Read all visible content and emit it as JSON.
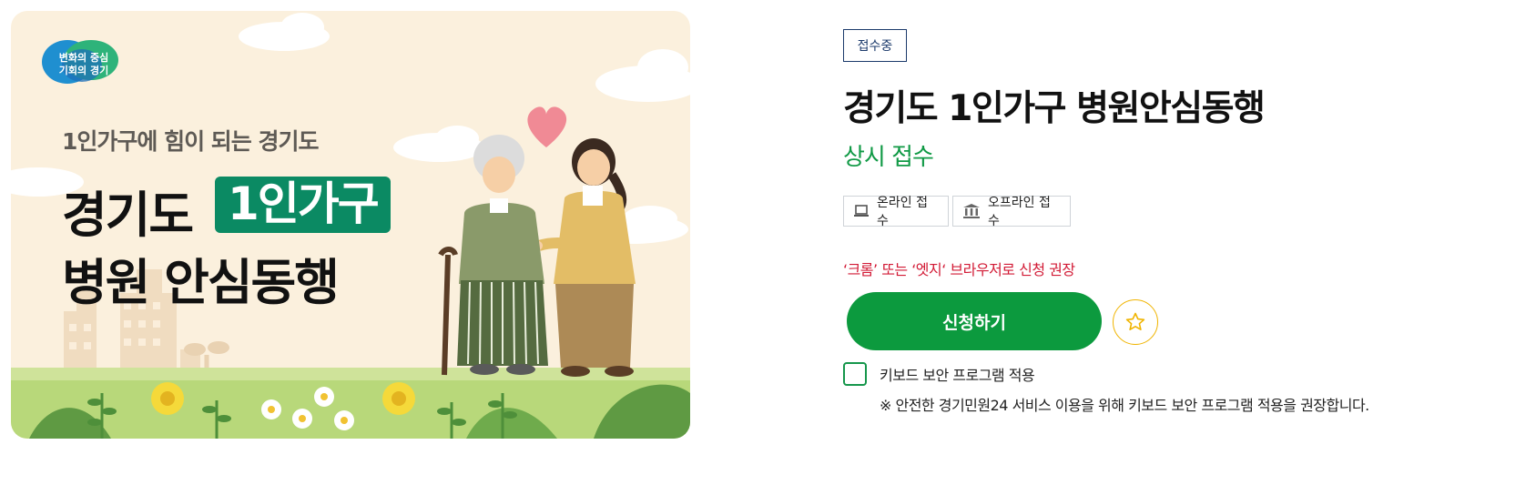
{
  "banner": {
    "logo_line1": "변화의 중심",
    "logo_line2": "기회의 경기",
    "subtitle": "1인가구에 힘이 되는 경기도",
    "title_part1": "경기도",
    "title_highlight": "1인가구",
    "title_line2": "병원 안심동행",
    "highlight_color": "#0b8a63",
    "background_color": "#fbf0dd"
  },
  "status_badge": "접수중",
  "title": "경기도 1인가구 병원안심동행",
  "period": "상시 접수",
  "methods": [
    {
      "label": "온라인 접수",
      "icon": "laptop-icon"
    },
    {
      "label": "오프라인 접수",
      "icon": "building-icon"
    }
  ],
  "browser_notice": "‘크롬’ 또는 ‘엣지‘ 브라우저로 신청 권장",
  "apply_button": "신청하기",
  "favorite_icon": "star-icon",
  "keyboard_security": {
    "label": "키보드 보안 프로그램 적용",
    "checked": false,
    "note": "※ 안전한 경기민원24 서비스 이용을 위해 키보드 보안 프로그램 적용을 권장합니다."
  },
  "colors": {
    "accent_green": "#0c9a3e",
    "notice_red": "#d21a35",
    "badge_navy": "#1b3a6b",
    "star_yellow": "#f0b400"
  }
}
